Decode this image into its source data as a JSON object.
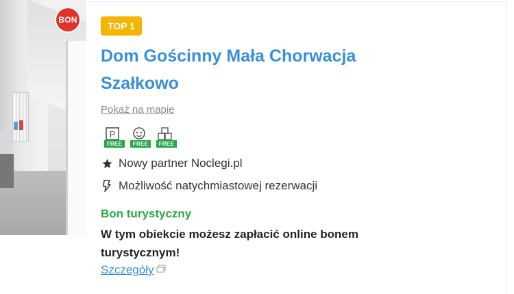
{
  "listing": {
    "bon_badge": "BON",
    "rank_badge": "TOP 1",
    "title": "Dom Gościnny Mała Chorwacja Szałkowo",
    "map_link": "Pokaż na mapie",
    "amenities": [
      {
        "icon": "parking-icon",
        "tag": "FREE"
      },
      {
        "icon": "child-icon",
        "tag": "FREE"
      },
      {
        "icon": "blocks-icon",
        "tag": "FREE"
      }
    ],
    "features": [
      {
        "icon": "star-icon",
        "text": "Nowy partner Noclegi.pl"
      },
      {
        "icon": "lightning-icon",
        "text": "Możliwość natychmiastowej rezerwacji"
      }
    ],
    "bon_section": {
      "title": "Bon turystyczny",
      "description": "W tym obiekcie możesz zapłacić online bonem turystycznym!",
      "link": "Szczegóły"
    }
  },
  "colors": {
    "title": "#3a8fd8",
    "rank_badge_bg": "#f5b400",
    "bon_badge_bg": "#e3312d",
    "free_green": "#2aa84a",
    "bon_title": "#2aa84a"
  }
}
